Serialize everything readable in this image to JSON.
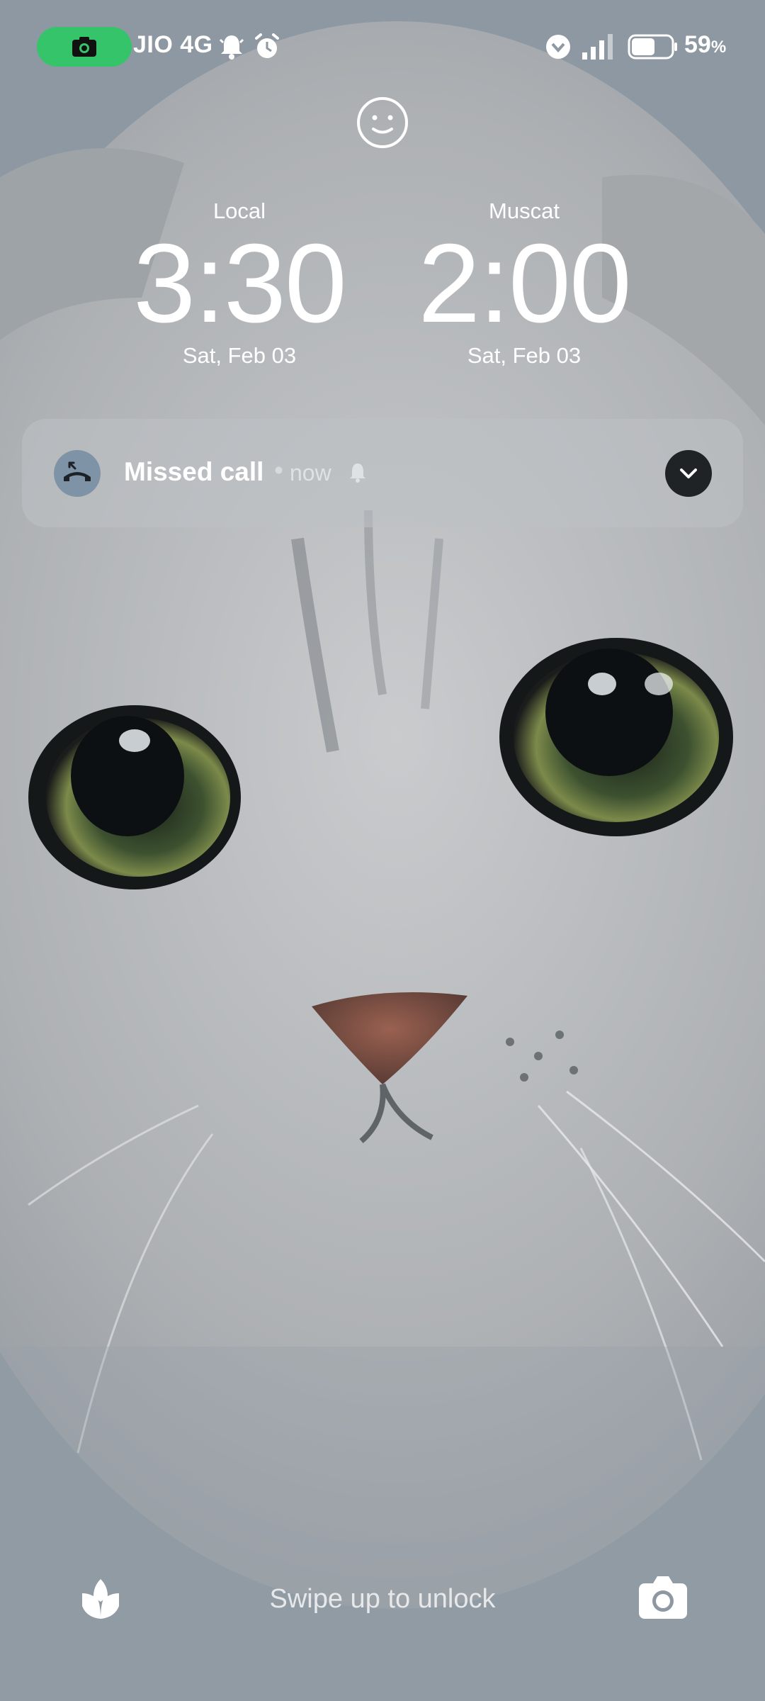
{
  "status_bar": {
    "carrier": "JIO 4G",
    "battery_percent": "59",
    "battery_percent_sign": "%",
    "battery_level": 0.59,
    "icons": [
      "camera-recording-icon",
      "notification-bell-icon",
      "alarm-clock-icon",
      "wifi-vpn-icon",
      "signal-bars-icon",
      "battery-icon"
    ],
    "recording_pill_color": "#35c46a"
  },
  "lock_icon": "face-smile-icon",
  "clocks": {
    "local": {
      "city": "Local",
      "time": "3:30",
      "date": "Sat, Feb 03"
    },
    "remote": {
      "city": "Muscat",
      "time": "2:00",
      "date": "Sat, Feb 03"
    }
  },
  "notification": {
    "title": "Missed call",
    "separator": "•",
    "time": "now",
    "icon": "missed-call-icon",
    "bell_icon": "bell-icon",
    "expand_icon": "chevron-down-icon"
  },
  "bottom": {
    "unlock_hint": "Swipe up to unlock",
    "left_icon": "lotus-icon",
    "right_icon": "camera-icon"
  }
}
